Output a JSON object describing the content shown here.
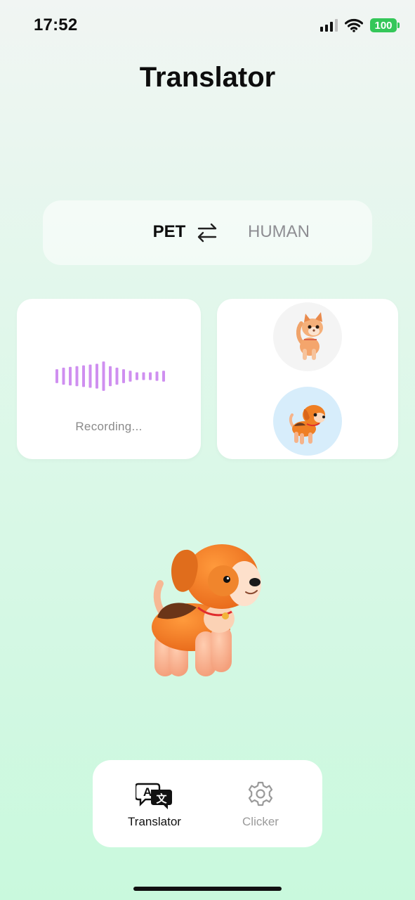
{
  "status_bar": {
    "time": "17:52",
    "battery": "100",
    "icons": [
      "signal-icon",
      "wifi-icon",
      "battery-icon"
    ],
    "battery_color": "#34c759"
  },
  "header": {
    "title": "Translator"
  },
  "direction": {
    "source": "PET",
    "target": "HUMAN",
    "swap_icon": "swap-arrows-icon"
  },
  "recording": {
    "status": "Recording...",
    "waveform_color": "#cf8ff0",
    "waveform_levels": [
      0.45,
      0.55,
      0.6,
      0.65,
      0.7,
      0.75,
      0.8,
      0.95,
      0.65,
      0.55,
      0.45,
      0.35,
      0.25,
      0.25,
      0.25,
      0.3,
      0.35
    ]
  },
  "pet_selector": {
    "options": [
      {
        "name": "cat",
        "icon": "cat-avatar-icon",
        "selected": false
      },
      {
        "name": "dog",
        "icon": "dog-avatar-icon",
        "selected": true
      }
    ],
    "selected_bg": "#d7edfb"
  },
  "tab_bar": {
    "tabs": [
      {
        "label": "Translator",
        "icon": "translate-icon",
        "active": true
      },
      {
        "label": "Clicker",
        "icon": "gear-icon",
        "active": false
      }
    ]
  }
}
